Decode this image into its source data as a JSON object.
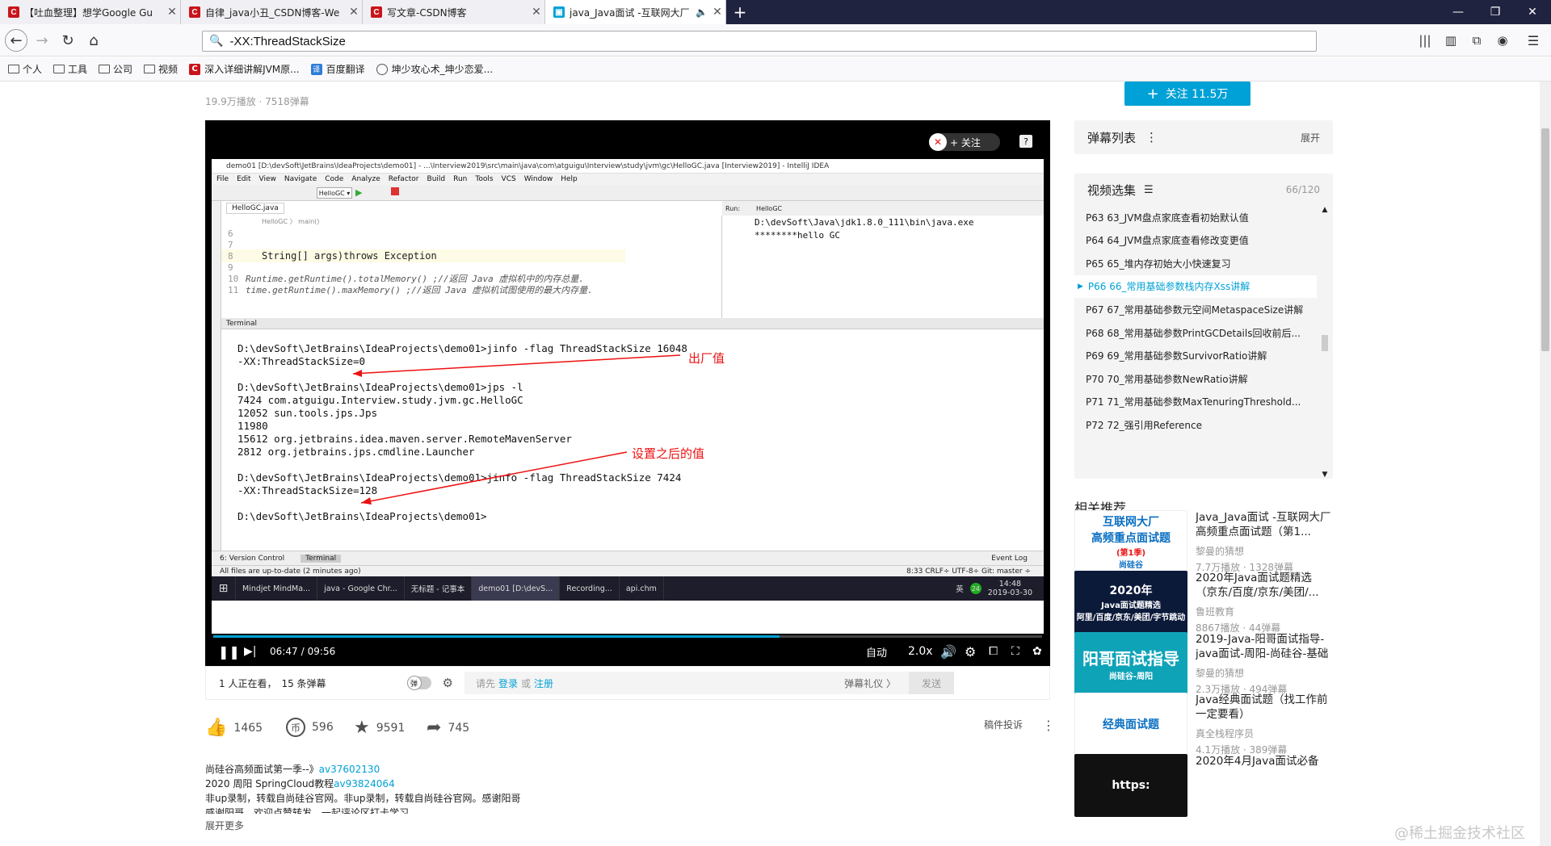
{
  "browser": {
    "tabs": [
      {
        "label": "【吐血整理】想学Google Gu",
        "active": false
      },
      {
        "label": "自律_java小丑_CSDN博客-We",
        "active": false
      },
      {
        "label": "写文章-CSDN博客",
        "active": false
      },
      {
        "label": "java_Java面试 -互联网大厂",
        "active": true
      }
    ],
    "url": "-XX:ThreadStackSize",
    "bookmarks": [
      "个人",
      "工具",
      "公司",
      "视频",
      "深入详细讲解JVM原...",
      "百度翻译",
      "坤少攻心术_坤少恋爱..."
    ]
  },
  "video_meta": {
    "stats": "19.9万播放 · 7518弹幕"
  },
  "follow_button": "关注 11.5万",
  "player": {
    "follow_badge": "+ 关注",
    "ide": {
      "title": "demo01 [D:\\devSoft\\JetBrains\\IdeaProjects\\demo01] - ...\\Interview2019\\src\\main\\java\\com\\atguigu\\Interview\\study\\jvm\\gc\\HelloGC.java [Interview2019] - IntelliJ IDEA",
      "menu": [
        "File",
        "Edit",
        "View",
        "Navigate",
        "Code",
        "Analyze",
        "Refactor",
        "Build",
        "Run",
        "Tools",
        "VCS",
        "Window",
        "Help"
      ],
      "file_tab": "HelloGC.java",
      "run_label": "Run:",
      "run_tab": "HelloGC",
      "breadcrumb": "HelloGC  〉  main()",
      "code_lines": [
        {
          "num": "6",
          "text": ""
        },
        {
          "num": "7",
          "text": ""
        },
        {
          "num": "8",
          "text": "String[] args)throws Exception"
        },
        {
          "num": "9",
          "text": ""
        },
        {
          "num": "10",
          "text": " Runtime.getRuntime().totalMemory() ;//返回 Java 虚拟机中的内存总量."
        },
        {
          "num": "11",
          "text": "time.getRuntime().maxMemory() ;//返回 Java 虚拟机试图使用的最大内存量."
        }
      ],
      "run_output": [
        "D:\\devSoft\\Java\\jdk1.8.0_111\\bin\\java.exe",
        "********hello GC"
      ],
      "terminal_label": "Terminal",
      "terminal_lines": [
        "D:\\devSoft\\JetBrains\\IdeaProjects\\demo01>jinfo -flag ThreadStackSize 16048",
        "-XX:ThreadStackSize=0",
        "",
        "D:\\devSoft\\JetBrains\\IdeaProjects\\demo01>jps -l",
        "7424 com.atguigu.Interview.study.jvm.gc.HelloGC",
        "12052 sun.tools.jps.Jps",
        "11980",
        "15612 org.jetbrains.idea.maven.server.RemoteMavenServer",
        "2812 org.jetbrains.jps.cmdline.Launcher",
        "",
        "D:\\devSoft\\JetBrains\\IdeaProjects\\demo01>jinfo -flag ThreadStackSize 7424",
        "-XX:ThreadStackSize=128",
        "",
        "D:\\devSoft\\JetBrains\\IdeaProjects\\demo01>"
      ],
      "annotation_factory": "出厂值",
      "annotation_after": "设置之后的值",
      "bottom_tabs": [
        "6: Version Control",
        "Terminal"
      ],
      "event_log": "Event Log",
      "status_left": "All files are up-to-date (2 minutes ago)",
      "status_right": "8:33  CRLF÷  UTF-8÷  Git: master ÷",
      "taskbar": [
        "Mindjet MindMa...",
        "java - Google Chr...",
        "无标题 - 记事本",
        "demo01 [D:\\devS...",
        "Recording...",
        "api.chm"
      ],
      "tray_time": "14:48",
      "tray_date": "2019-03-30",
      "tray_lang": "英",
      "tray_num": "24"
    },
    "time_current": "06:47",
    "time_total": "09:56",
    "progress": 0.683,
    "quality": "自动",
    "speed": "2.0x"
  },
  "below_player": {
    "watching": "1 人正在看，",
    "danmaku_count": "15 条弹幕",
    "login_prompt": "请先",
    "login": "登录",
    "or": "或",
    "register": "注册",
    "etiquette": "弹幕礼仪 〉",
    "send": "发送",
    "danmaku_toggle": "弹"
  },
  "actions": {
    "like": "1465",
    "coin": "596",
    "favorite": "9591",
    "share": "745",
    "report": "稿件投诉"
  },
  "description": {
    "line1_text": "尚硅谷高频面试第一季--》",
    "line1_link": "av37602130",
    "line2_text": "2020 周阳 SpringCloud教程",
    "line2_link": "av93824064",
    "line3": "非up录制，转载自尚硅谷官网。非up录制，转载自尚硅谷官网。感谢阳哥",
    "line4": "感谢阳哥，欢迎点赞转发，一起评论区打卡学习",
    "more": "展开更多"
  },
  "danmaku_list": {
    "title": "弹幕列表",
    "expand": "展开"
  },
  "episodes": {
    "title": "视频选集",
    "count": "66/120",
    "items": [
      {
        "label": "P63   63_JVM盘点家底查看初始默认值",
        "current": false
      },
      {
        "label": "P64   64_JVM盘点家底查看修改变更值",
        "current": false
      },
      {
        "label": "P65   65_堆内存初始大小快速复习",
        "current": false
      },
      {
        "label": "P66   66_常用基础参数栈内存Xss讲解",
        "current": true
      },
      {
        "label": "P67   67_常用基础参数元空间MetaspaceSize讲解",
        "current": false
      },
      {
        "label": "P68   68_常用基础参数PrintGCDetails回收前后...",
        "current": false
      },
      {
        "label": "P69   69_常用基础参数SurvivorRatio讲解",
        "current": false
      },
      {
        "label": "P70   70_常用基础参数NewRatio讲解",
        "current": false
      },
      {
        "label": "P71   71_常用基础参数MaxTenuringThreshold...",
        "current": false
      },
      {
        "label": "P72   72_强引用Reference",
        "current": false
      }
    ]
  },
  "recommend": {
    "title": "相关推荐",
    "items": [
      {
        "title": "Java_Java面试 -互联网大厂高频重点面试题（第1...",
        "up": "黎曼的猜想",
        "stats": "7.7万播放 · 1328弹幕",
        "thumb_lines": [
          "互联网大厂",
          "高频重点面试题",
          "(第1季)",
          "尚硅谷"
        ]
      },
      {
        "title": "2020年Java面试题精选（京东/百度/京东/美团/...",
        "up": "鲁班教育",
        "stats": "8867播放 · 44弹幕",
        "thumb_lines": [
          "2020年",
          "Java面试题精选",
          "阿里/百度/京东/美团/字节跳动"
        ]
      },
      {
        "title": "2019-Java-阳哥面试指导-java面试-周阳-尚硅谷-基础",
        "up": "黎曼的猜想",
        "stats": "2.3万播放 · 494弹幕",
        "thumb_lines": [
          "阳哥面试指导",
          "尚硅谷-周阳"
        ]
      },
      {
        "title": "Java经典面试题（找工作前一定要看）",
        "up": "真全栈程序员",
        "stats": "4.1万播放 · 389弹幕",
        "thumb_lines": [
          "经典面试题"
        ]
      },
      {
        "title": "2020年4月Java面试必备",
        "up": "",
        "stats": "",
        "thumb_lines": [
          "https:"
        ]
      }
    ]
  },
  "watermark": "@稀土掘金技术社区",
  "colors": {
    "accent": "#00a1d6",
    "annotation": "#e11111",
    "tabbar": "#202340"
  }
}
